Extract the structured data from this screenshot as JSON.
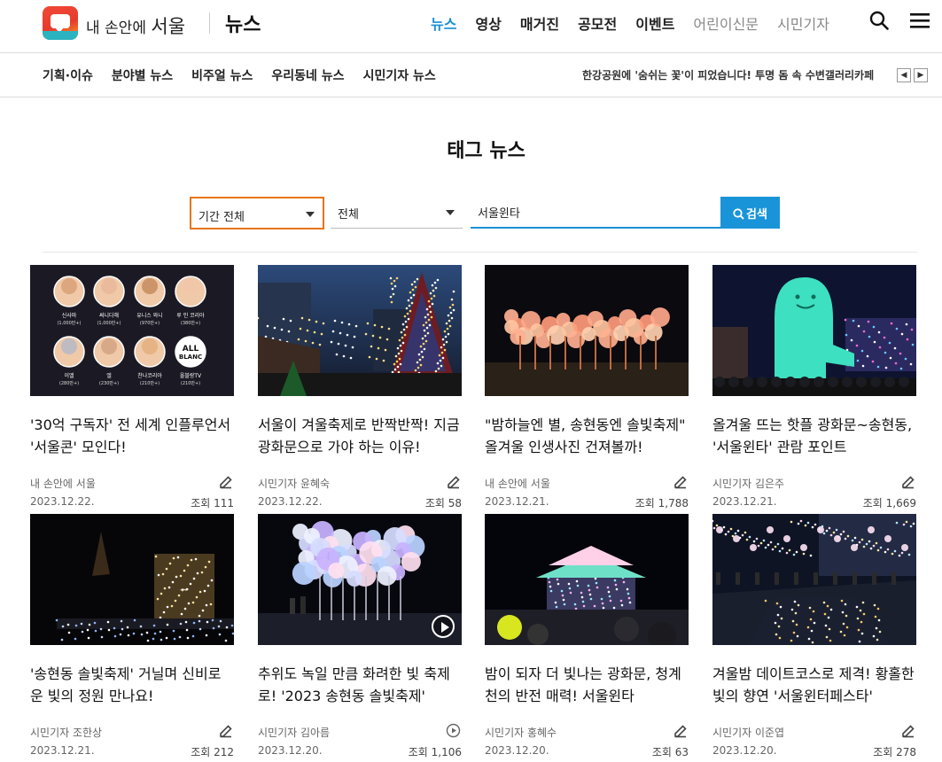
{
  "header": {
    "site_prefix": "내 손안에",
    "site_city": "서울",
    "section": "뉴스",
    "nav": [
      {
        "label": "뉴스",
        "style": "active"
      },
      {
        "label": "영상",
        "style": ""
      },
      {
        "label": "매거진",
        "style": ""
      },
      {
        "label": "공모전",
        "style": ""
      },
      {
        "label": "이벤트",
        "style": ""
      },
      {
        "label": "어린이신문",
        "style": "muted"
      },
      {
        "label": "시민기자",
        "style": "muted"
      }
    ],
    "icons": {
      "search": "search-icon",
      "menu": "hamburger-menu-icon"
    }
  },
  "subnav": {
    "items": [
      "기획·이슈",
      "분야별 뉴스",
      "비주얼 뉴스",
      "우리동네 뉴스",
      "시민기자 뉴스"
    ],
    "ticker": "한강공원에 '숨쉬는 꽃'이 피었습니다! 투명 돔 속 수변갤러리카페",
    "ticker_prev": "◀",
    "ticker_next": "▶"
  },
  "page": {
    "title": "태그 뉴스"
  },
  "filters": {
    "period": "기간 전체",
    "category": "전체",
    "query": "서울윈타",
    "search_button": "검색"
  },
  "cards": [
    {
      "title": "'30억 구독자' 전 세계 인플루언서 '서울콘' 모인다!",
      "author": "내 손안에 서울",
      "date": "2023.12.22.",
      "views": "조회 111",
      "type": "edit-icon",
      "video": false
    },
    {
      "title": "서울이 겨울축제로 반짝반짝! 지금 광화문으로 가야 하는 이유!",
      "author": "시민기자 윤혜숙",
      "date": "2023.12.22.",
      "views": "조회 58",
      "type": "edit-icon",
      "video": false
    },
    {
      "title": "\"밤하늘엔 별, 송현동엔 솔빛축제\" 올겨울 인생사진 건져볼까!",
      "author": "내 손안에 서울",
      "date": "2023.12.21.",
      "views": "조회 1,788",
      "type": "edit-icon",
      "video": false
    },
    {
      "title": "올겨울 뜨는 핫플 광화문~송현동, '서울윈타' 관람 포인트",
      "author": "시민기자 김은주",
      "date": "2023.12.21.",
      "views": "조회 1,669",
      "type": "edit-icon",
      "video": false
    },
    {
      "title": "'송현동 솔빛축제' 거닐며 신비로운 빛의 정원 만나요!",
      "author": "시민기자 조한상",
      "date": "2023.12.21.",
      "views": "조회 212",
      "type": "edit-icon",
      "video": false
    },
    {
      "title": "추위도 녹일 만큼 화려한 빛 축제로! '2023 송현동 솔빛축제'",
      "author": "시민기자 김아름",
      "date": "2023.12.20.",
      "views": "조회 1,106",
      "type": "play-icon",
      "video": true
    },
    {
      "title": "밤이 되자 더 빛나는 광화문, 청계천의 반전 매력! 서울윈타",
      "author": "시민기자 홍혜수",
      "date": "2023.12.20.",
      "views": "조회 63",
      "type": "edit-icon",
      "video": false
    },
    {
      "title": "겨울밤 데이트코스로 제격! 황홀한 빛의 향연 '서울윈터페스타'",
      "author": "시민기자 이준엽",
      "date": "2023.12.20.",
      "views": "조회 278",
      "type": "edit-icon",
      "video": false
    }
  ],
  "influencers": {
    "names": [
      "신사마",
      "써니다해",
      "유니스 와니",
      "루 인 코리아",
      "이엘",
      "엘",
      "찬나코리아",
      "올블랑TV"
    ],
    "counts": [
      "(1,000만+)",
      "(1,000만+)",
      "(970만+)",
      "(380만+)",
      "(280만+)",
      "(230만+)",
      "(210만+)",
      "(210만+)"
    ],
    "logo_top": "ALL",
    "logo_bottom": "BLANC"
  }
}
